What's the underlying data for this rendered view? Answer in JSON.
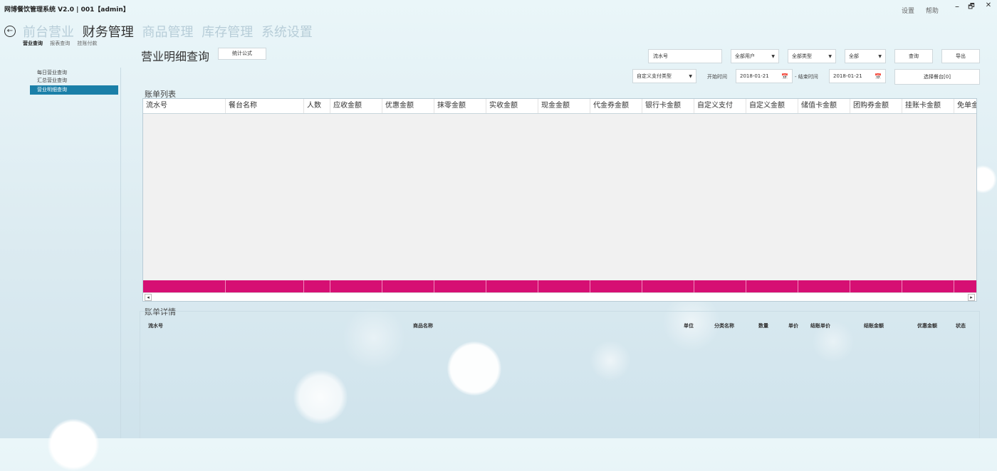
{
  "window": {
    "title": "网博餐饮管理系统 V2.0 | 001【admin】",
    "links": [
      "设置",
      "帮助"
    ],
    "controls": [
      "–",
      "🗗",
      "✕"
    ]
  },
  "nav": {
    "main": [
      "前台营业",
      "财务管理",
      "商品管理",
      "库存管理",
      "系统设置"
    ],
    "active_index": 1,
    "sub": [
      "营业查询",
      "报表查询",
      "挂账付款"
    ],
    "sub_active_index": 0
  },
  "sidebar": {
    "items": [
      "每日营业查询",
      "汇总营业查询",
      "营业明细查询"
    ],
    "active_index": 2
  },
  "page": {
    "title": "营业明细查询",
    "formula_button": "统计公式"
  },
  "filters": {
    "serial_placeholder": "流水号",
    "user_select": "全部用户",
    "type_select": "全部类型",
    "all_select": "全部",
    "query_button": "查询",
    "export_button": "导出",
    "custom_pay_select": "自定义支付类型",
    "start_label": "开始时间",
    "start_date": "2018-01-21",
    "end_label": "- 结束时间",
    "end_date": "2018-01-21",
    "select_table_button": "选择餐台[0]"
  },
  "bill_list": {
    "title": "账单列表",
    "columns": [
      "流水号",
      "餐台名称",
      "人数",
      "应收金额",
      "优惠金额",
      "抹零金额",
      "实收金额",
      "现金金额",
      "代金券金额",
      "银行卡金额",
      "自定义支付",
      "自定义金额",
      "储值卡金额",
      "团购券金额",
      "挂账卡金额",
      "免单金额"
    ],
    "rows": []
  },
  "bill_detail": {
    "title": "账单详情",
    "columns": [
      "流水号",
      "商品名称",
      "单位",
      "分类名称",
      "数量",
      "单价",
      "结账单价",
      "结账金额",
      "优惠金额",
      "状态"
    ],
    "rows": []
  },
  "colors": {
    "accent": "#1a7fa8",
    "total_row": "#d60f73"
  },
  "icons": {
    "back": "arrow-left-circle-icon",
    "calendar": "calendar-icon",
    "dropdown": "chevron-down-icon"
  }
}
